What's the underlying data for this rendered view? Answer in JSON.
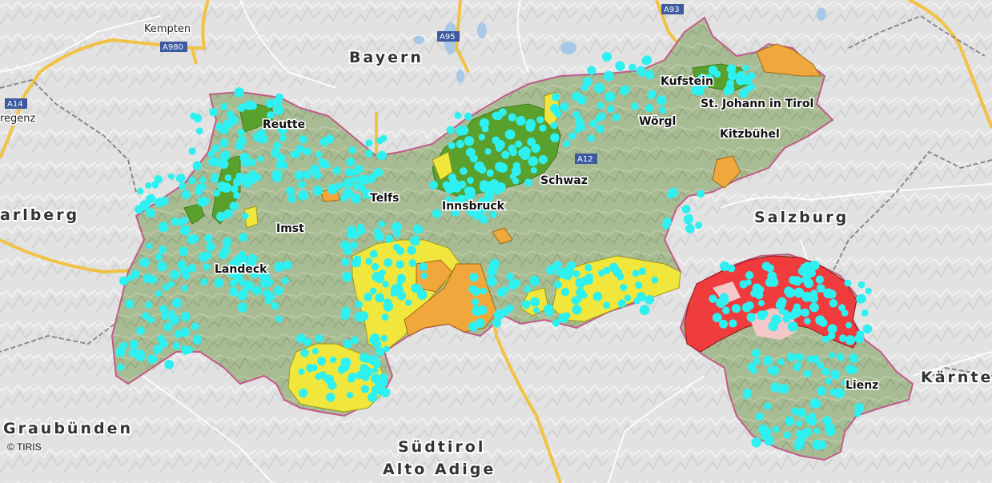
{
  "map": {
    "regions": {
      "bayern": "Bayern",
      "salzburg": "Salzburg",
      "arlberg": "arlberg",
      "graubuenden": "Graubünden",
      "suedtirol": "Südtirol",
      "alto_adige": "Alto Adige",
      "kaernten": "Kärnte"
    },
    "towns": {
      "kempten": "Kempten",
      "bregenz": "regenz",
      "reutte": "Reutte",
      "telfs": "Telfs",
      "imst": "Imst",
      "landeck": "Landeck",
      "innsbruck": "Innsbruck",
      "schwaz": "Schwaz",
      "woergl": "Wörgl",
      "kufstein": "Kufstein",
      "st_johann": "St. Johann in Tirol",
      "kitzbuehel": "Kitzbühel",
      "lienz": "Lienz"
    },
    "roads": {
      "a980": "A980",
      "a95": "A95",
      "a93": "A93",
      "a14": "A14",
      "a12": "A12"
    },
    "colors": {
      "boundary": "#c25b8a",
      "dark_green": "#5aa02c",
      "yellow": "#f0e63c",
      "orange": "#f0a83c",
      "red": "#f03c3c",
      "pink": "#f4c8c8",
      "markers": "#2ef0f0"
    },
    "copyright": "© TIRIS"
  }
}
